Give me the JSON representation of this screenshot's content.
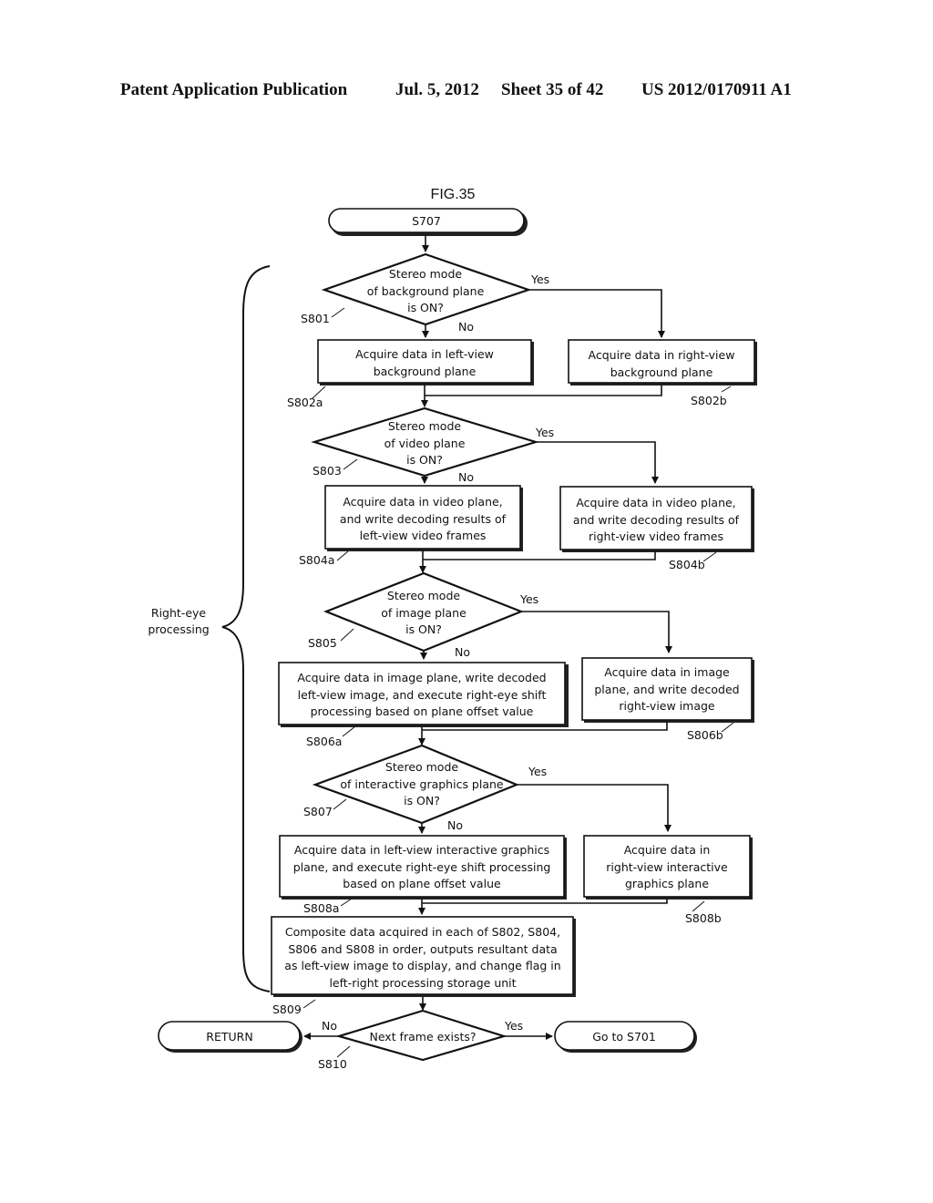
{
  "header": {
    "publication": "Patent Application Publication",
    "date": "Jul. 5, 2012",
    "sheet": "Sheet 35 of 42",
    "number": "US 2012/0170911 A1"
  },
  "figure": {
    "title": "FIG.35",
    "brace_label": [
      "Right-eye",
      "processing"
    ],
    "start": "S707",
    "decisions": [
      {
        "id": "S801",
        "lines": [
          "Stereo mode",
          "of background plane",
          "is ON?"
        ],
        "yes": "Yes",
        "no": "No"
      },
      {
        "id": "S803",
        "lines": [
          "Stereo mode",
          "of video plane",
          "is ON?"
        ],
        "yes": "Yes",
        "no": "No"
      },
      {
        "id": "S805",
        "lines": [
          "Stereo mode",
          "of image plane",
          "is ON?"
        ],
        "yes": "Yes",
        "no": "No"
      },
      {
        "id": "S807",
        "lines": [
          "Stereo mode",
          "of interactive graphics plane",
          "is ON?"
        ],
        "yes": "Yes",
        "no": "No"
      },
      {
        "id": "S810",
        "lines": [
          "Next frame exists?"
        ],
        "yes": "Yes",
        "no": "No"
      }
    ],
    "left_boxes": [
      {
        "id": "S802a",
        "lines": [
          "Acquire data in left-view",
          "background plane"
        ]
      },
      {
        "id": "S804a",
        "lines": [
          "Acquire data in video plane,",
          "and write decoding results of",
          "left-view video frames"
        ]
      },
      {
        "id": "S806a",
        "lines": [
          "Acquire data in image plane, write decoded",
          "left-view image, and execute right-eye shift",
          "processing based on plane offset value"
        ]
      },
      {
        "id": "S808a",
        "lines": [
          "Acquire data in left-view interactive graphics",
          "plane, and execute right-eye shift processing",
          "based on plane offset value"
        ]
      }
    ],
    "right_boxes": [
      {
        "id": "S802b",
        "lines": [
          "Acquire data in right-view",
          "background plane"
        ]
      },
      {
        "id": "S804b",
        "lines": [
          "Acquire data in video plane,",
          "and write decoding results of",
          "right-view video frames"
        ]
      },
      {
        "id": "S806b",
        "lines": [
          "Acquire data in image",
          "plane, and write decoded",
          "right-view image"
        ]
      },
      {
        "id": "S808b",
        "lines": [
          "Acquire data in",
          "right-view interactive",
          "graphics plane"
        ]
      }
    ],
    "composite": {
      "id": "S809",
      "lines": [
        "Composite data acquired in each of S802, S804,",
        "S806 and S808 in order, outputs resultant data",
        "as left-view image to display, and change flag in",
        "left-right processing storage unit"
      ]
    },
    "terminal_no": "RETURN",
    "terminal_yes": "Go to S701"
  }
}
